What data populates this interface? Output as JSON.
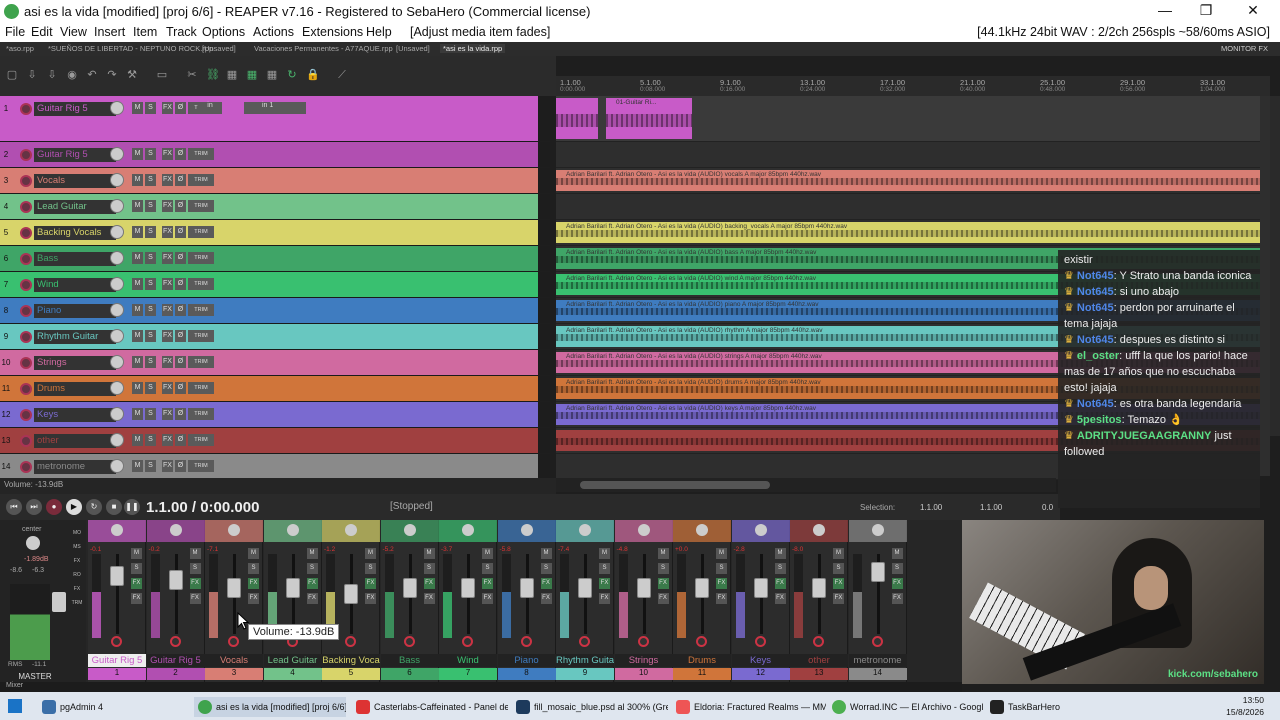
{
  "window": {
    "title": "asi es la vida [modified] [proj 6/6] - REAPER v7.16 - Registered to SebaHero (Commercial license)",
    "minimize": "—",
    "maximize": "❐",
    "close": "✕"
  },
  "menu": {
    "items": [
      "File",
      "Edit",
      "View",
      "Insert",
      "Item",
      "Track",
      "Options",
      "Actions",
      "Extensions",
      "Help"
    ],
    "hint": "[Adjust media item fades]",
    "format": "[44.1kHz 24bit WAV : 2/2ch 256spls ~58/60ms ASIO]"
  },
  "project_tabs": {
    "items": [
      "*aso.rpp",
      "*SUEÑOS DE LIBERTAD - NEPTUNO ROCK.rpp",
      "[Unsaved]",
      "Vacaciones Permanentes - A77AQUE.rpp",
      "[Unsaved]",
      "*asi es la vida.rpp"
    ],
    "active": 5,
    "monitor_fx": "MONITOR FX"
  },
  "ruler": {
    "marks": [
      "1.1.00",
      "5.1.00",
      "9.1.00",
      "13.1.00",
      "17.1.00",
      "21.1.00",
      "25.1.00",
      "29.1.00",
      "33.1.00"
    ],
    "times": [
      "0:00.000",
      "0:08.000",
      "0:16.000",
      "0:24.000",
      "0:32.000",
      "0:40.000",
      "0:48.000",
      "0:56.000",
      "1:04.000"
    ]
  },
  "tracks": [
    {
      "num": "1",
      "name": "Guitar Rig 5",
      "color": "#c85bc8",
      "input": "in 1",
      "armed": true
    },
    {
      "num": "2",
      "name": "Guitar Rig 5",
      "color": "#b14fb1"
    },
    {
      "num": "3",
      "name": "Vocals",
      "color": "#d87e74"
    },
    {
      "num": "4",
      "name": "Lead Guitar",
      "color": "#72c28a"
    },
    {
      "num": "5",
      "name": "Backing Vocals",
      "color": "#d8d46a"
    },
    {
      "num": "6",
      "name": "Bass",
      "color": "#3fa567"
    },
    {
      "num": "7",
      "name": "Wind",
      "color": "#39c070"
    },
    {
      "num": "8",
      "name": "Piano",
      "color": "#3f7cc0"
    },
    {
      "num": "9",
      "name": "Rhythm Guitar",
      "color": "#68c7c0"
    },
    {
      "num": "10",
      "name": "Strings",
      "color": "#d06aa0"
    },
    {
      "num": "11",
      "name": "Drums",
      "color": "#d0753a"
    },
    {
      "num": "12",
      "name": "Keys",
      "color": "#7a6ad0"
    },
    {
      "num": "13",
      "name": "other",
      "color": "#a04040"
    },
    {
      "num": "14",
      "name": "metronome",
      "color": "#8a8a8a"
    }
  ],
  "clip_labels": {
    "t1": "01-Guitar Ri...",
    "t3": "Adrian Barilari ft. Adrian Otero - Asi es la vida (AUDIO) vocals A major 85bpm 440hz.wav",
    "t5": "Adrian Barilari ft. Adrian Otero - Asi es la vida (AUDIO) backing_vocals A major 85bpm 440hz.wav",
    "t6": "Adrian Barilari ft. Adrian Otero - Asi es la vida (AUDIO) bass A major 85bpm 440hz.wav",
    "t7": "Adrian Barilari ft. Adrian Otero - Asi es la vida (AUDIO) wind A major 85bpm 440hz.wav",
    "t8": "Adrian Barilari ft. Adrian Otero - Asi es la vida (AUDIO) piano A major 85bpm 440hz.wav",
    "t9": "Adrian Barilari ft. Adrian Otero - Asi es la vida (AUDIO) rhythm A major 85bpm 440hz.wav",
    "t10": "Adrian Barilari ft. Adrian Otero - Asi es la vida (AUDIO) strings A major 85bpm 440hz.wav",
    "t11": "Adrian Barilari ft. Adrian Otero - Asi es la vida (AUDIO) drums A major 85bpm 440hz.wav",
    "t12": "Adrian Barilari ft. Adrian Otero - Asi es la vida (AUDIO) keys A major 85bpm 440hz.wav"
  },
  "status": {
    "volume": "Volume: -13.9dB"
  },
  "transport": {
    "time": "1.1.00 / 0:00.000",
    "state": "[Stopped]",
    "selection_label": "Selection:",
    "sel_start": "1.1.00",
    "sel_end": "1.1.00",
    "sel_len": "0.0"
  },
  "chat": [
    {
      "user": "",
      "text": "existir"
    },
    {
      "user": "Not645",
      "text": ": Y Strato una banda iconica"
    },
    {
      "user": "Not645",
      "text": ": si uno abajo"
    },
    {
      "user": "Not645",
      "text": ": perdon por arruinarte el tema jajaja"
    },
    {
      "user": "Not645",
      "text": ": despues es distinto si"
    },
    {
      "user": "el_oster",
      "text": ": ufff la que los pario! hace mas de 17 años que no escuchaba esto! jajaja"
    },
    {
      "user": "Not645",
      "text": ": es otra banda legendaria"
    },
    {
      "user": "5pesitos",
      "text": ": Temazo 👌"
    },
    {
      "user": "ADRITYJUEGAAGRANNY",
      "text": " just followed"
    }
  ],
  "mixer": {
    "master": {
      "label": "MASTER",
      "pan": "center",
      "peak": "-1.89dB",
      "l": "-8.6",
      "r": "-6.3",
      "rms": "RMS",
      "rms_val": "-11.1"
    },
    "strips": [
      {
        "label": "Guitar Rig 5",
        "idx": "1",
        "peak": "-0.1",
        "color": "#c85bc8"
      },
      {
        "label": "Guitar Rig 5",
        "idx": "2",
        "peak": "-0.2",
        "color": "#b14fb1"
      },
      {
        "label": "Vocals",
        "idx": "3",
        "peak": "-7.1",
        "color": "#d87e74"
      },
      {
        "label": "Lead Guitar",
        "idx": "4",
        "peak": "",
        "color": "#72c28a"
      },
      {
        "label": "Backing Voca",
        "idx": "5",
        "peak": "-1.2",
        "color": "#d8d46a"
      },
      {
        "label": "Bass",
        "idx": "6",
        "peak": "-5.2",
        "color": "#3fa567"
      },
      {
        "label": "Wind",
        "idx": "7",
        "peak": "-3.7",
        "color": "#39c070"
      },
      {
        "label": "Piano",
        "idx": "8",
        "peak": "-5.8",
        "color": "#3f7cc0"
      },
      {
        "label": "Rhythm Guita",
        "idx": "9",
        "peak": "-7.4",
        "color": "#68c7c0"
      },
      {
        "label": "Strings",
        "idx": "10",
        "peak": "-4.8",
        "color": "#d06aa0"
      },
      {
        "label": "Drums",
        "idx": "11",
        "peak": "+0.0",
        "color": "#d0753a"
      },
      {
        "label": "Keys",
        "idx": "12",
        "peak": "-2.8",
        "color": "#7a6ad0"
      },
      {
        "label": "other",
        "idx": "13",
        "peak": "-8.0",
        "color": "#a04040"
      },
      {
        "label": "metronome",
        "idx": "14",
        "peak": "",
        "color": "#8a8a8a"
      }
    ],
    "tooltip": "Volume: -13.9dB",
    "tab": "Mixer"
  },
  "webcam": {
    "tag": "kick.com/sebahero"
  },
  "taskbar": {
    "items": [
      "pgAdmin 4",
      "asi es la vida [modified] [proj 6/6] ...",
      "Casterlabs-Caffeinated - Panel de ...",
      "fill_mosaic_blue.psd al 300% (Gree...",
      "Eldoria: Fractured Realms — MM...",
      "Worrad.INC — El Archivo - Googl...",
      "TaskBarHero"
    ],
    "time": "13:50",
    "date": "15/8/2026"
  }
}
